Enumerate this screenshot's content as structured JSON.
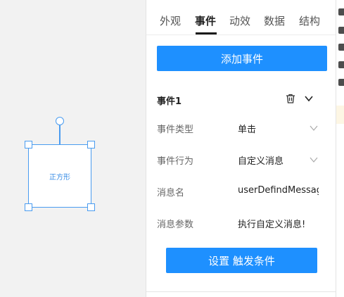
{
  "canvas": {
    "shape_label": "正方形"
  },
  "panel": {
    "tabs": [
      {
        "label": "外观",
        "active": false
      },
      {
        "label": "事件",
        "active": true
      },
      {
        "label": "动效",
        "active": false
      },
      {
        "label": "数据",
        "active": false
      },
      {
        "label": "结构",
        "active": false
      }
    ],
    "add_event_label": "添加事件",
    "event": {
      "title": "事件1",
      "fields": [
        {
          "label": "事件类型",
          "value": "单击",
          "dropdown": true
        },
        {
          "label": "事件行为",
          "value": "自定义消息",
          "dropdown": true
        },
        {
          "label": "消息名",
          "value": "userDefindMessage",
          "dropdown": false
        },
        {
          "label": "消息参数",
          "value": "执行自定义消息!",
          "dropdown": false
        }
      ]
    },
    "trigger_button_label": "设置 触发条件"
  },
  "colors": {
    "accent": "#1e90ff",
    "selection": "#4a9cf0"
  }
}
